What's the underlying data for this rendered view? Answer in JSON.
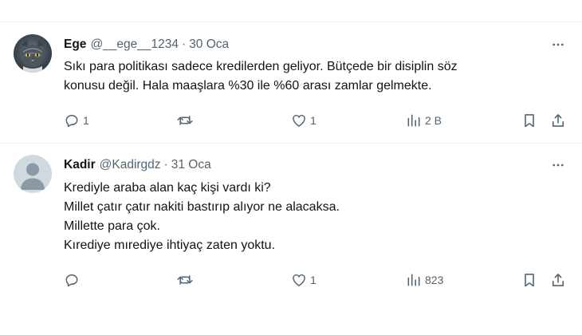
{
  "tweets": [
    {
      "name": "Ege",
      "handle": "@__ege__1234",
      "separator": "·",
      "date": "30 Oca",
      "avatar_icon": "cat-photo-avatar",
      "lines": [
        "Sıkı para politikası sadece kredilerden geliyor. Bütçede bir disiplin söz",
        "konusu değil. Hala maaşlara %30 ile %60 arası zamlar gelmekte."
      ],
      "replies": "1",
      "retweets": "",
      "likes": "1",
      "views": "2 B"
    },
    {
      "name": "Kadir",
      "handle": "@Kadirgdz",
      "separator": "·",
      "date": "31 Oca",
      "avatar_icon": "default-profile-avatar",
      "lines": [
        "Krediyle araba alan kaç kişi vardı ki?",
        "Millet çatır çatır nakiti bastırıp alıyor ne alacaksa.",
        "Millette para çok.",
        "Kırediye mırediye ihtiyaç zaten yoktu."
      ],
      "replies": "",
      "retweets": "",
      "likes": "1",
      "views": "823"
    }
  ],
  "colors": {
    "text": "#0f1419",
    "secondary": "#536471",
    "border": "#eff3f4",
    "default_avatar_bg": "#cfd9de",
    "default_avatar_fg": "#8b98a5"
  }
}
